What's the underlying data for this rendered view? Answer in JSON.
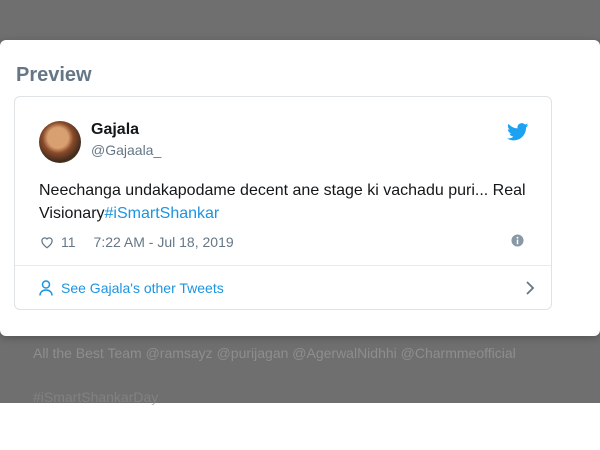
{
  "modal": {
    "title": "Preview"
  },
  "tweet": {
    "display_name": "Gajala",
    "handle": "@Gajaala_",
    "text": "Neechanga undakapodame decent ane stage ki vachadu puri... Real Visionary",
    "hashtag": "#iSmartShankar",
    "like_count": "11",
    "timestamp": "7:22 AM - Jul 18, 2019",
    "footer_link": "See Gajala's other Tweets"
  },
  "background": {
    "line_prefix": "All the Best Team",
    "mentions": [
      "@ramsayz",
      "@purijagan",
      "@AgerwalNidhhi",
      "@Charmmeofficial"
    ],
    "hashtag": "#iSmartShankarDay"
  },
  "colors": {
    "accent": "#1b95e0",
    "text_primary": "#14171a",
    "text_secondary": "#657786",
    "backdrop": "#6f6f6f"
  },
  "icons": [
    "twitter-bird-icon",
    "heart-icon",
    "info-icon",
    "person-icon",
    "chevron-right-icon"
  ]
}
